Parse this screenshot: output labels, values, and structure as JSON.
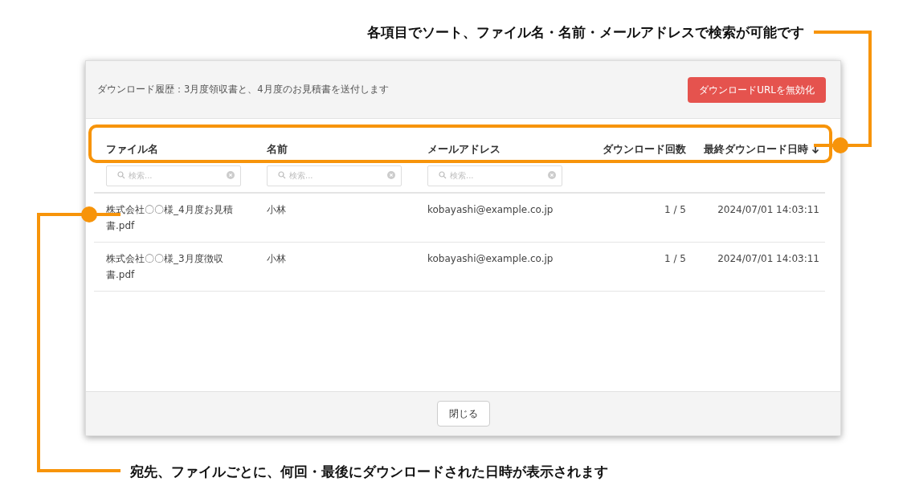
{
  "annotations": {
    "top": "各項目でソート、ファイル名・名前・メールアドレスで検索が可能です",
    "bottom": "宛先、ファイルごとに、何回・最後にダウンロードされた日時が表示されます"
  },
  "dialog": {
    "title": "ダウンロード履歴：3月度領収書と、4月度のお見積書を送付します",
    "action_button": "ダウンロードURLを無効化",
    "close_button": "閉じる"
  },
  "table": {
    "columns": [
      {
        "label": "ファイル名",
        "kind": "text",
        "sorted": false,
        "filter": {
          "placeholder": "検索..."
        }
      },
      {
        "label": "名前",
        "kind": "text",
        "sorted": false,
        "filter": {
          "placeholder": "検索..."
        }
      },
      {
        "label": "メールアドレス",
        "kind": "text",
        "sorted": false,
        "filter": {
          "placeholder": "検索..."
        }
      },
      {
        "label": "ダウンロード回数",
        "kind": "number",
        "sorted": false
      },
      {
        "label": "最終ダウンロード日時",
        "kind": "number",
        "sorted": true
      }
    ],
    "rows": [
      [
        "株式会社〇〇様_4月度お見積書.pdf",
        "小林",
        "kobayashi@example.co.jp",
        "1 / 5",
        "2024/07/01 14:03:11"
      ],
      [
        "株式会社〇〇様_3月度徴収書.pdf",
        "小林",
        "kobayashi@example.co.jp",
        "1 / 5",
        "2024/07/01 14:03:11"
      ]
    ]
  }
}
